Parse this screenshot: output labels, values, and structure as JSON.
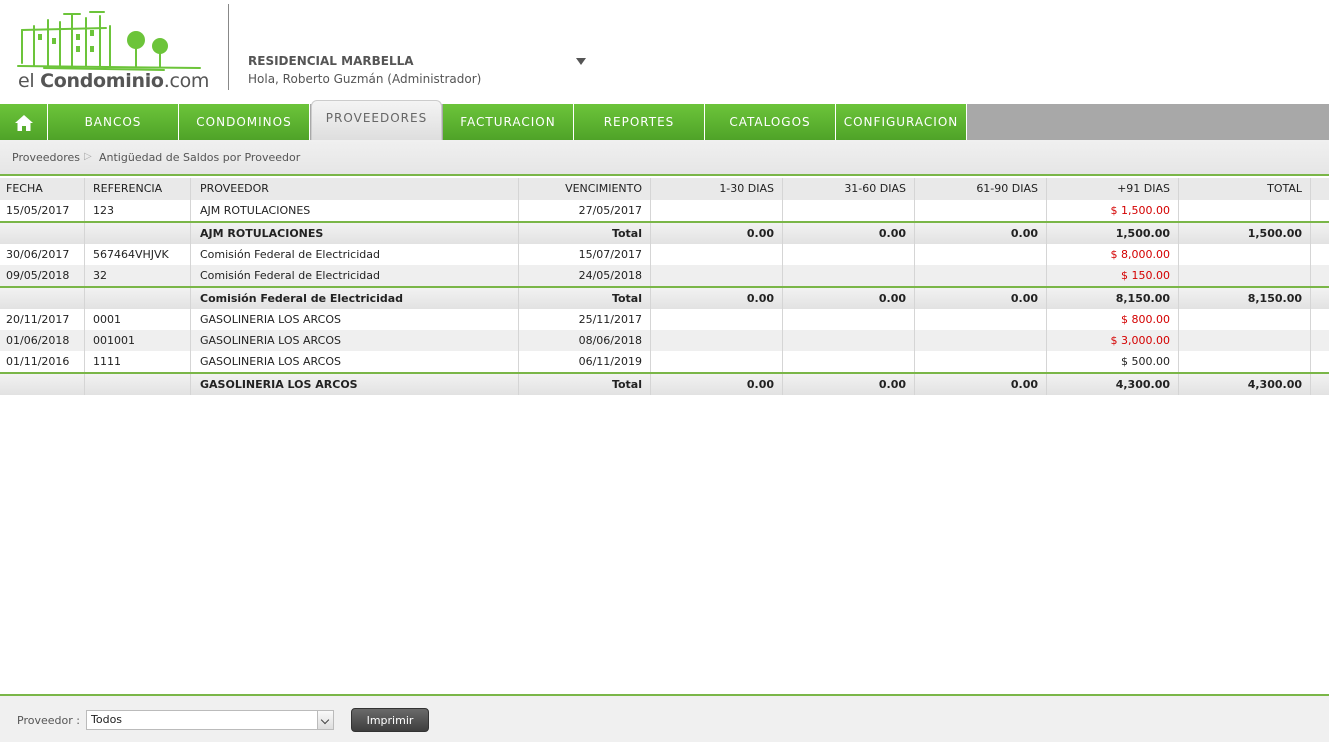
{
  "logo": {
    "prefix": "el ",
    "brand": "Condominio",
    "suffix": ".com"
  },
  "header": {
    "condo_name": "RESIDENCIAL MARBELLA",
    "greeting": "Hola, Roberto Guzmán (Administrador)"
  },
  "nav": {
    "items": [
      "BANCOS",
      "CONDOMINOS",
      "PROVEEDORES",
      "FACTURACION",
      "REPORTES",
      "CATALOGOS",
      "CONFIGURACION"
    ],
    "active": "PROVEEDORES"
  },
  "breadcrumb": {
    "parent": "Proveedores",
    "current": "Antigüedad de Saldos por Proveedor"
  },
  "table": {
    "headers": [
      "FECHA",
      "REFERENCIA",
      "PROVEEDOR",
      "VENCIMIENTO",
      "1-30 DIAS",
      "31-60 DIAS",
      "61-90 DIAS",
      "+91 DIAS",
      "TOTAL"
    ],
    "total_label": "Total",
    "rows": [
      {
        "fecha": "15/05/2017",
        "ref": "123",
        "prov": "AJM ROTULACIONES",
        "venc": "27/05/2017",
        "d91": "$ 1,500.00"
      },
      {
        "prov": "AJM ROTULACIONES",
        "d1": "0.00",
        "d31": "0.00",
        "d61": "0.00",
        "d91": "1,500.00",
        "total": "1,500.00"
      },
      {
        "fecha": "30/06/2017",
        "ref": "567464VHJVK",
        "prov": "Comisión Federal de Electricidad",
        "venc": "15/07/2017",
        "d91": "$ 8,000.00"
      },
      {
        "fecha": "09/05/2018",
        "ref": "32",
        "prov": "Comisión Federal de Electricidad",
        "venc": "24/05/2018",
        "d91": "$ 150.00"
      },
      {
        "prov": "Comisión Federal de Electricidad",
        "d1": "0.00",
        "d31": "0.00",
        "d61": "0.00",
        "d91": "8,150.00",
        "total": "8,150.00"
      },
      {
        "fecha": "20/11/2017",
        "ref": "0001",
        "prov": "GASOLINERIA LOS ARCOS",
        "venc": "25/11/2017",
        "d91": "$ 800.00"
      },
      {
        "fecha": "01/06/2018",
        "ref": "001001",
        "prov": "GASOLINERIA LOS ARCOS",
        "venc": "08/06/2018",
        "d91": "$ 3,000.00"
      },
      {
        "fecha": "01/11/2016",
        "ref": "1111",
        "prov": "GASOLINERIA LOS ARCOS",
        "venc": "06/11/2019",
        "d91": "$ 500.00"
      },
      {
        "prov": "GASOLINERIA LOS ARCOS",
        "d1": "0.00",
        "d31": "0.00",
        "d61": "0.00",
        "d91": "4,300.00",
        "total": "4,300.00"
      }
    ]
  },
  "footer": {
    "label": "Proveedor :",
    "select_value": "Todos",
    "print_button": "Imprimir"
  },
  "colors": {
    "accent_green": "#5cb030",
    "overdue_red": "#d40000"
  }
}
